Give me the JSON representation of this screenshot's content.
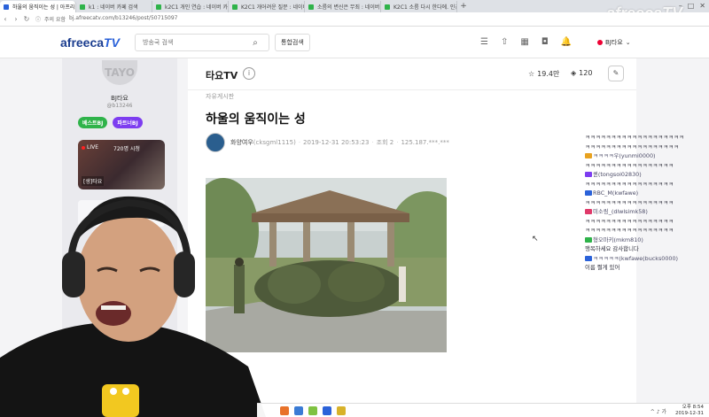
{
  "browser": {
    "tabs": [
      {
        "label": "하울의 움직이는 성 | 아프리카티",
        "color": "#2b62d9"
      },
      {
        "label": "k1 : 네이버 카페 검색",
        "color": "#2fb34a"
      },
      {
        "label": "k2C1 개인 연습 : 네이버 카",
        "color": "#2fb34a"
      },
      {
        "label": "K2C1 개어려운 질문 : 네이버 카",
        "color": "#2fb34a"
      },
      {
        "label": "소름의 변신은 무죄 : 네이버 카",
        "color": "#2fb34a"
      },
      {
        "label": "K2C1 소름 다시 한다에. 인간이",
        "color": "#2fb34a"
      }
    ],
    "new_tab": "+",
    "url_secure": "주의 요함",
    "url": "bj.afreecatv.com/b13246/post/50715097",
    "watermark": "afreecaTV",
    "window_controls": [
      "–",
      "□",
      "✕"
    ]
  },
  "header": {
    "logo_main": "afreeca",
    "logo_tv": "TV",
    "search_placeholder": "방송국 검색",
    "search_icon": "search-icon",
    "total_search": "통합검색",
    "icons": [
      "list-icon",
      "upload-icon",
      "film-icon",
      "camera-icon",
      "bell-icon"
    ],
    "user": "BJ타요"
  },
  "sidebar": {
    "avatar_text": "TAYO",
    "nickname": "BJ타요",
    "user_id": "@b13246",
    "badges": [
      "베스트BJ",
      "파트너BJ"
    ],
    "live": {
      "tag": "LIVE",
      "viewers": "720명 시청",
      "label": "[생]타요"
    }
  },
  "main": {
    "channel_name": "타요TV",
    "info_icon": "i",
    "favorites": "19.4만",
    "subscribers": "120",
    "category": "자유게시판",
    "title": "하울의 움직이는 성",
    "author": "화양여우",
    "author_id": "(cksgml1115)",
    "date": "2019-12-31 20:53:23",
    "views": "조회 2",
    "ip": "125.187.***.***"
  },
  "chat": [
    {
      "text": "ㅋㅋㅋㅋㅋㅋㅋㅋㅋㅋㅋㅋㅋㅋㅋㅋㅋㅋㅋ",
      "icon": ""
    },
    {
      "text": "ㅋㅋㅋㅋㅋㅋㅋㅋㅋㅋㅋㅋㅋㅋㅋㅋㅋㅋ",
      "icon": ""
    },
    {
      "text": "ㅋㅋㅋㅋ우(yunmi0000)",
      "icon": "#e8a21f"
    },
    {
      "text": "ㅋㅋㅋㅋㅋㅋㅋㅋㅋㅋㅋㅋㅋㅋㅋㅋㅋ",
      "icon": ""
    },
    {
      "text": "퀸(tongsoi02830)",
      "icon": "#7d3df0"
    },
    {
      "text": "ㅋㅋㅋㅋㅋㅋㅋㅋㅋㅋㅋㅋㅋㅋㅋㅋㅋ",
      "icon": ""
    },
    {
      "text": "RBC_M(kwfawe)",
      "icon": "#2b62d9"
    },
    {
      "text": "ㅋㅋㅋㅋㅋㅋㅋㅋㅋㅋㅋㅋㅋㅋㅋㅋㅋ",
      "icon": ""
    },
    {
      "text": "미소링_(dlwlsimk58)",
      "icon": "#e03a6a"
    },
    {
      "text": "ㅋㅋㅋㅋㅋㅋㅋㅋㅋㅋㅋㅋㅋㅋㅋㅋㅋ",
      "icon": ""
    },
    {
      "text": "ㅋㅋㅋㅋㅋㅋㅋㅋㅋㅋㅋㅋㅋㅋㅋㅋㅋ",
      "icon": ""
    },
    {
      "text": "형오마키(mkm810)",
      "icon": "#2fb34a"
    },
    {
      "text": "행복하세요 감사합니다",
      "icon": ""
    },
    {
      "text": "ㅋㅋㅋㅋㅋ(kwfawe(bucks0000)",
      "icon": "#2b62d9"
    },
    {
      "text": "이름 쩔게 있어",
      "icon": ""
    }
  ],
  "taskbar": {
    "tray": "^ ♪ 가",
    "time": "오후 8:54",
    "date": "2019-12-31"
  }
}
